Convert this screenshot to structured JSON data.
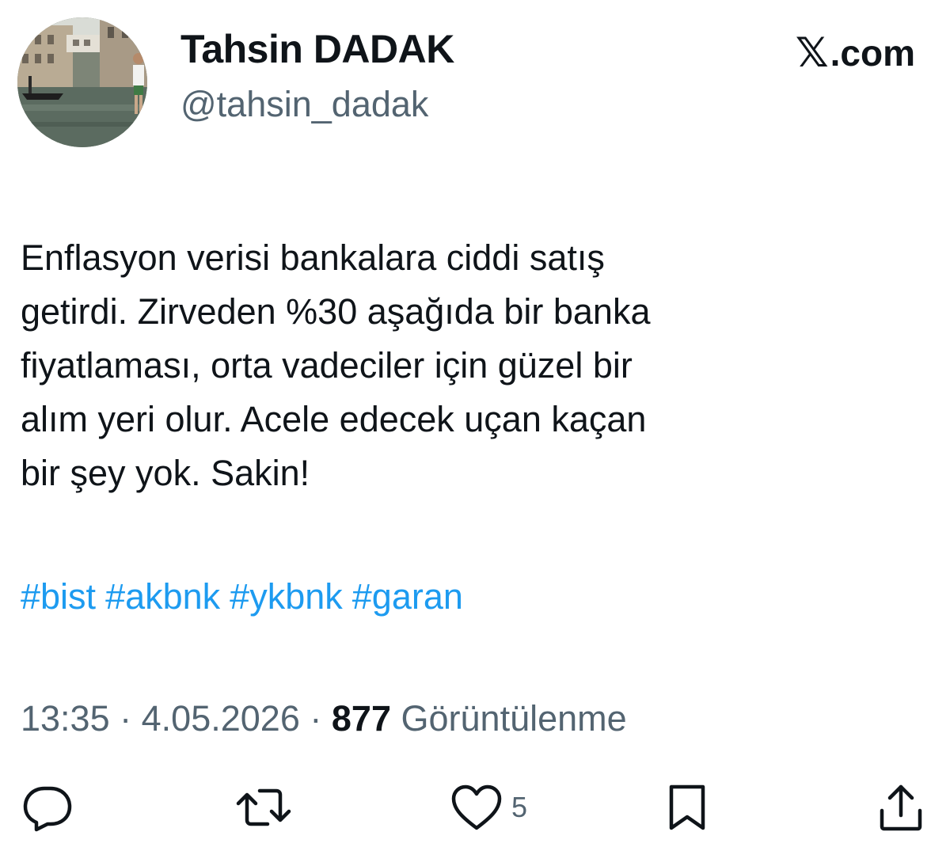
{
  "user": {
    "display_name": "Tahsin DADAK",
    "handle": "@tahsin_dadak"
  },
  "brand": {
    "x_glyph": "𝕏",
    "domain": ".com"
  },
  "tweet": {
    "text": "Enflasyon verisi bankalara ciddi satış\ngetirdi. Zirveden %30 aşağıda bir banka\nfiyatlaması, orta vadeciler için güzel bir\nalım yeri olur. Acele edecek uçan kaçan\nbir şey yok. Sakin!",
    "hashtags": [
      "#bist",
      "#akbnk",
      "#ykbnk",
      "#garan"
    ]
  },
  "meta": {
    "time": "13:35",
    "separator": "·",
    "date": "4.05.2026",
    "views_count": "877",
    "views_label": "Görüntülenme"
  },
  "actions": {
    "reply_icon": "reply-icon",
    "retweet_icon": "retweet-icon",
    "like_icon": "heart-icon",
    "like_count": "5",
    "bookmark_icon": "bookmark-icon",
    "share_icon": "share-icon"
  },
  "colors": {
    "text": "#0f1419",
    "secondary": "#536471",
    "link": "#1d9bf0"
  }
}
